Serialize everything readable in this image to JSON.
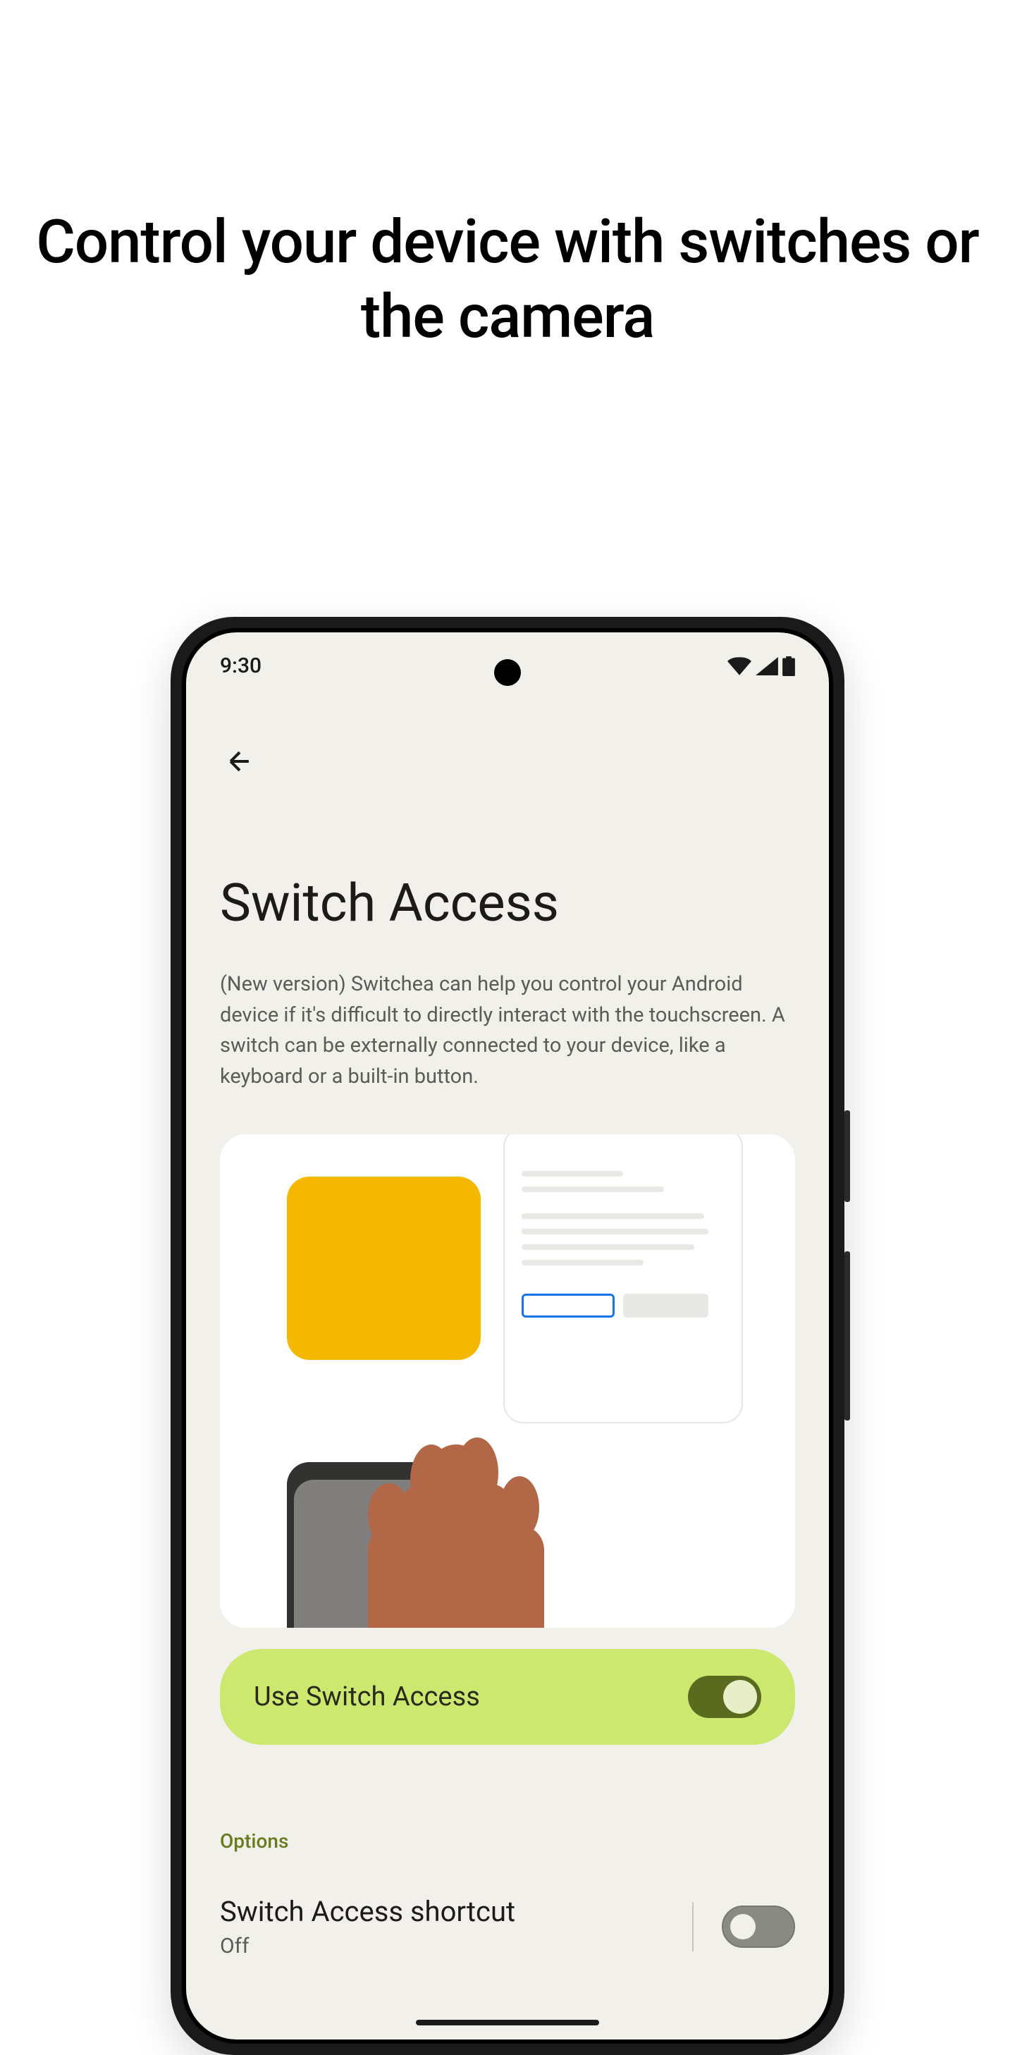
{
  "marketing": {
    "title": "Control your device with switches or the camera"
  },
  "status": {
    "time": "9:30"
  },
  "screen": {
    "title": "Switch Access",
    "description": "(New version) Switchea can help you control your Android device if it's difficult to directly interact with the touchscreen. A switch can be externally connected to your device, like a keyboard or a built-in button."
  },
  "main_toggle": {
    "label": "Use Switch Access"
  },
  "options": {
    "section_label": "Options",
    "shortcut": {
      "title": "Switch Access shortcut",
      "status": "Off"
    }
  }
}
